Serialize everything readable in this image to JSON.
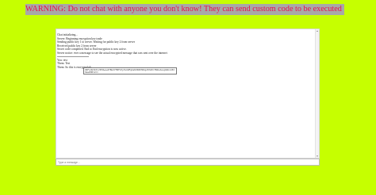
{
  "warning": "WARNING: Do not chat with anyone you don't know! They can send custom code to be executed by your browser!",
  "chat": {
    "lines": [
      "Chat initializing...",
      "Server: Beginning encryption key trade",
      "Sending public key 1 to server. Waiting for public key 2 from server",
      "Received public key 2 from server",
      "Secret code completed. End to End encryption is now active.",
      "Server notice: ever a message to see the actual encrypted message that was sent over the internet"
    ],
    "messages": [
      "You: test",
      "Them: Test",
      "Them: So this is encrypted eh"
    ],
    "encrypted_text": "U2FsdGVkX1/0PUwww4fBpI7H9Fk3yXvkWFgbsKZ2WXHdmgJ9h4Or3NZw4wvgAWxxx8dhGw0HXl2=="
  },
  "input": {
    "placeholder": "Type a message..."
  },
  "colors": {
    "background": "#c6ff00",
    "warning_bar": "#a8a8a8",
    "warning_text": "#e8124a"
  }
}
